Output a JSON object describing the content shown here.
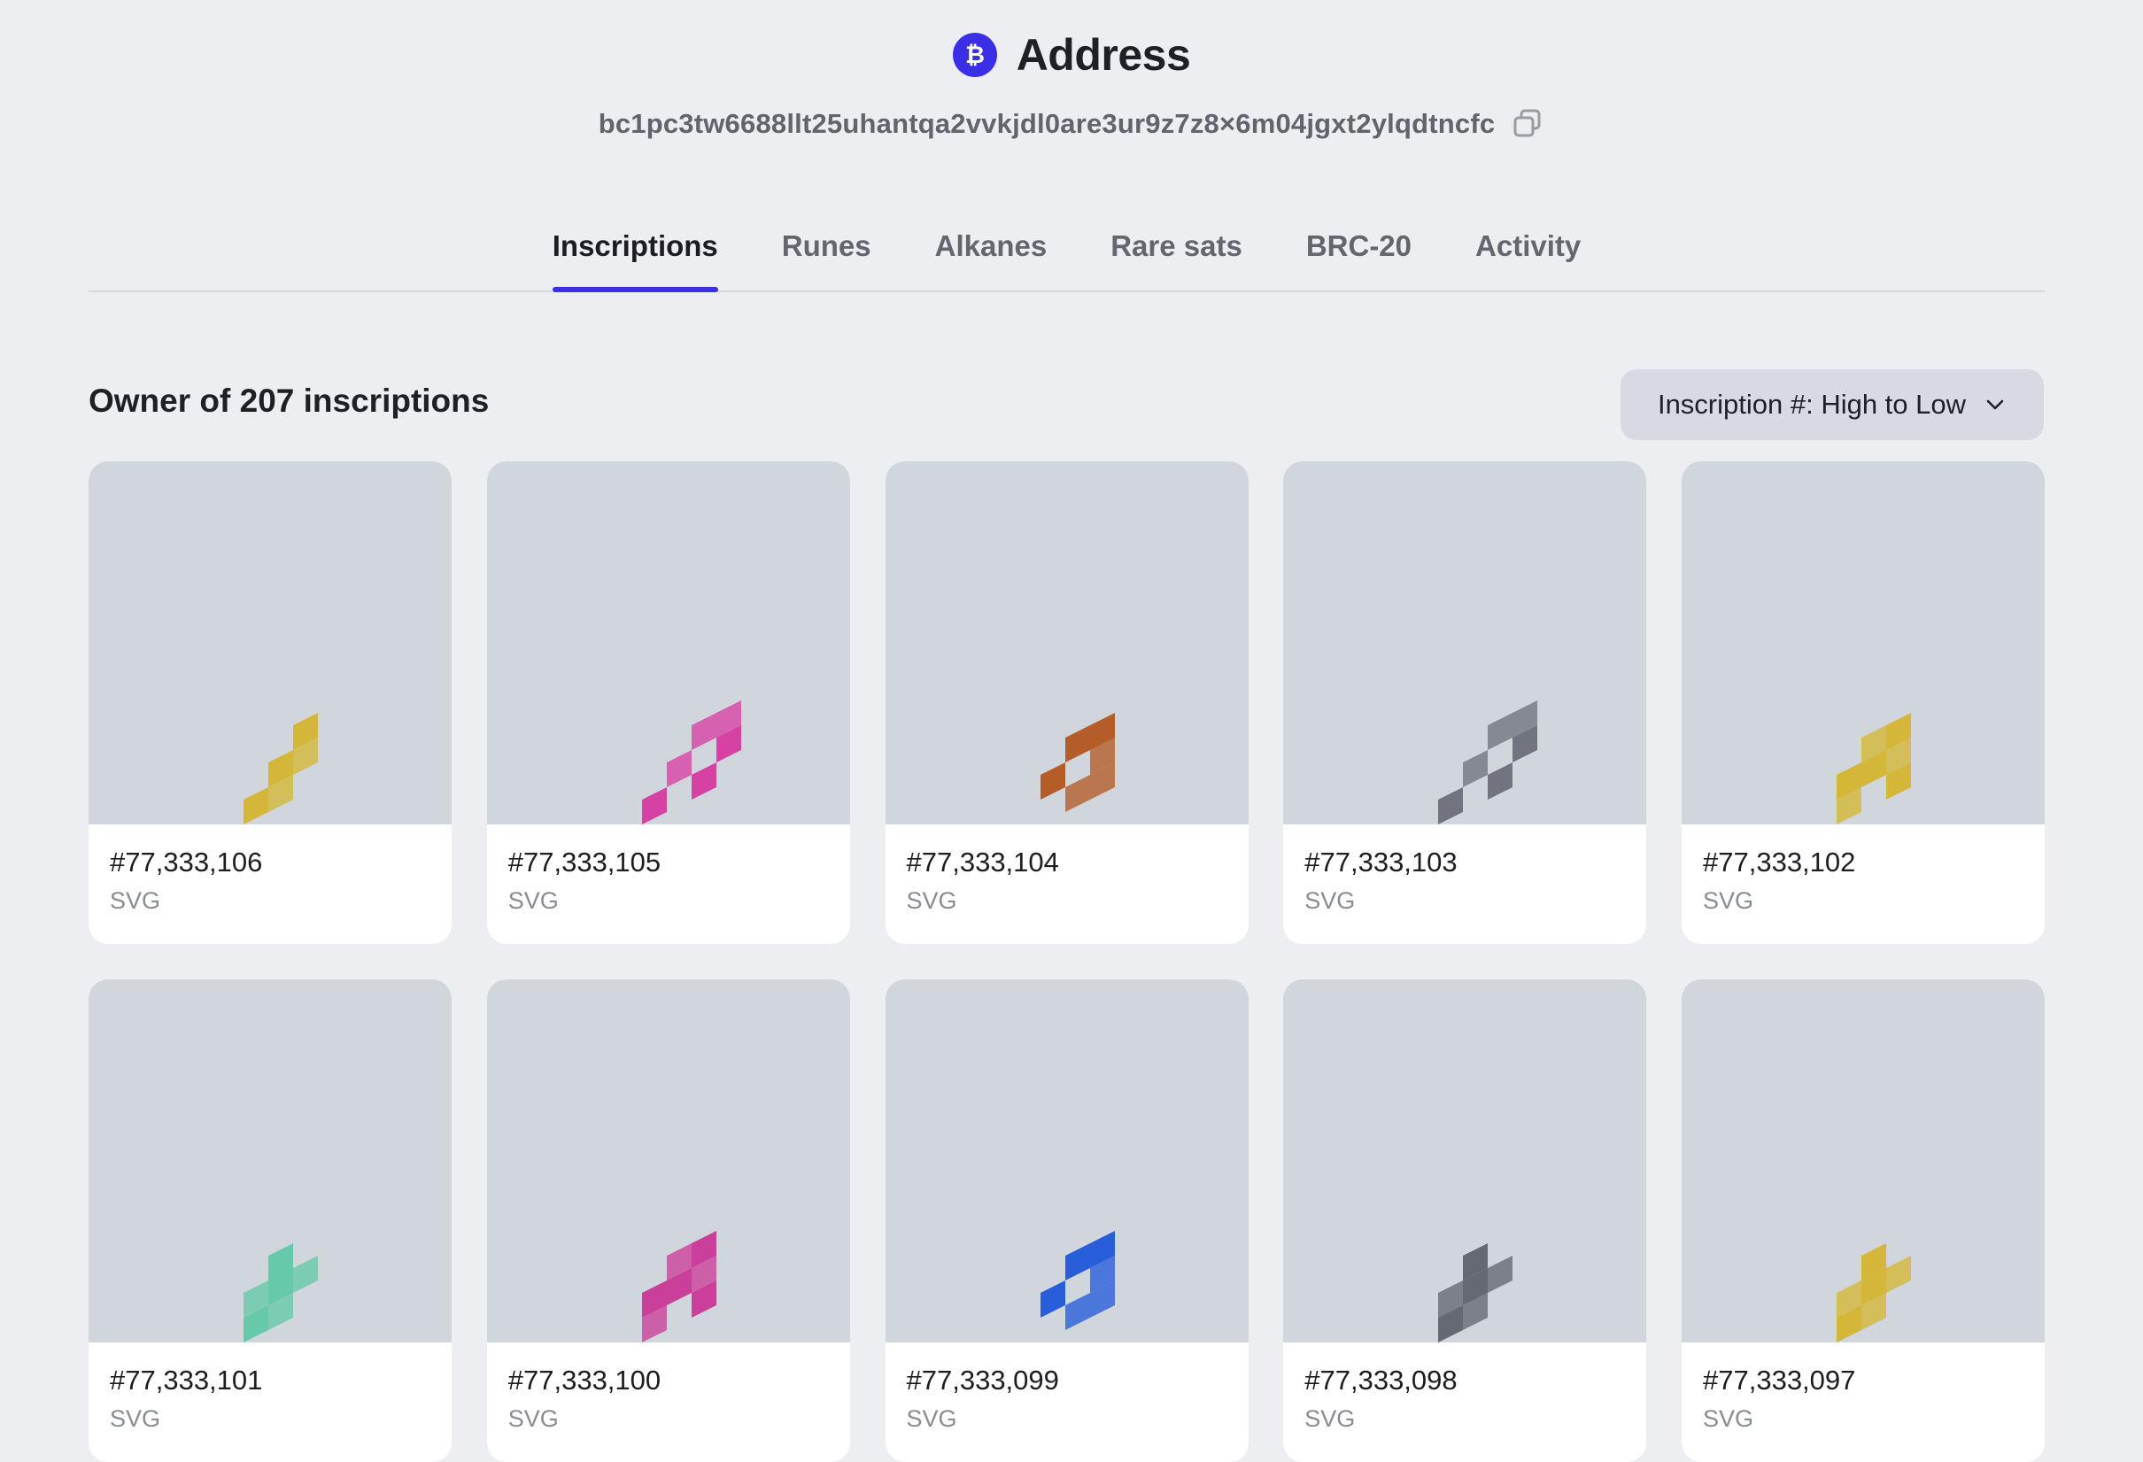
{
  "header": {
    "title": "Address",
    "address": "bc1pc3tw6688llt25uhantqa2vvkjdl0are3ur9z7z8×6m04jgxt2ylqdtncfc",
    "icon": "bitcoin-icon",
    "accent": "#3a2fe6"
  },
  "tabs": [
    {
      "label": "Inscriptions",
      "active": true
    },
    {
      "label": "Runes",
      "active": false
    },
    {
      "label": "Alkanes",
      "active": false
    },
    {
      "label": "Rare sats",
      "active": false
    },
    {
      "label": "BRC-20",
      "active": false
    },
    {
      "label": "Activity",
      "active": false
    }
  ],
  "toolbar": {
    "owner_label": "Owner of 207 inscriptions",
    "sort_label": "Inscription #: High to Low"
  },
  "inscriptions": [
    {
      "number": "#77,333,106",
      "type": "SVG",
      "color": "#d4b52e",
      "pattern": "diagonal"
    },
    {
      "number": "#77,333,105",
      "type": "SVG",
      "color": "#d63aa0",
      "pattern": "checker"
    },
    {
      "number": "#77,333,104",
      "type": "SVG",
      "color": "#b2561e",
      "pattern": "stairs"
    },
    {
      "number": "#77,333,103",
      "type": "SVG",
      "color": "#6b6f78",
      "pattern": "checker"
    },
    {
      "number": "#77,333,102",
      "type": "SVG",
      "color": "#d4b52e",
      "pattern": "block"
    },
    {
      "number": "#77,333,101",
      "type": "SVG",
      "color": "#5fc8a6",
      "pattern": "cross"
    },
    {
      "number": "#77,333,100",
      "type": "SVG",
      "color": "#c93796",
      "pattern": "block"
    },
    {
      "number": "#77,333,099",
      "type": "SVG",
      "color": "#1f57d8",
      "pattern": "stairs"
    },
    {
      "number": "#77,333,098",
      "type": "SVG",
      "color": "#5f636c",
      "pattern": "cross"
    },
    {
      "number": "#77,333,097",
      "type": "SVG",
      "color": "#d4b52e",
      "pattern": "cross"
    }
  ]
}
